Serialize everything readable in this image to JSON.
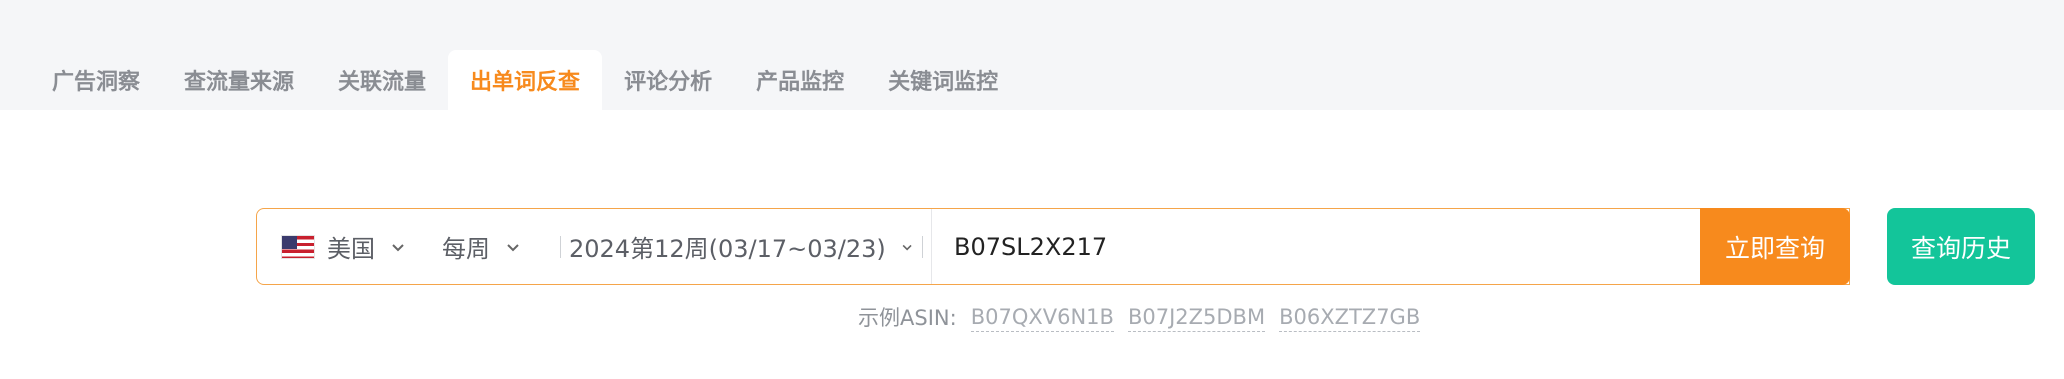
{
  "tabs": [
    {
      "label": "广告洞察",
      "active": false
    },
    {
      "label": "查流量来源",
      "active": false
    },
    {
      "label": "关联流量",
      "active": false
    },
    {
      "label": "出单词反查",
      "active": true
    },
    {
      "label": "评论分析",
      "active": false
    },
    {
      "label": "产品监控",
      "active": false
    },
    {
      "label": "关键词监控",
      "active": false
    }
  ],
  "search": {
    "country": "美国",
    "country_icon": "us-flag-icon",
    "period": "每周",
    "week": "2024第12周(03/17~03/23)",
    "asin_value": "B07SL2X217"
  },
  "buttons": {
    "query": "立即查询",
    "history": "查询历史"
  },
  "examples": {
    "label": "示例ASIN:",
    "items": [
      "B07QXV6N1B",
      "B07J2Z5DBM",
      "B06XZTZ7GB"
    ]
  },
  "colors": {
    "accent_orange": "#f78a1d",
    "accent_green": "#13c59a",
    "tab_bg": "#f5f6f8"
  }
}
